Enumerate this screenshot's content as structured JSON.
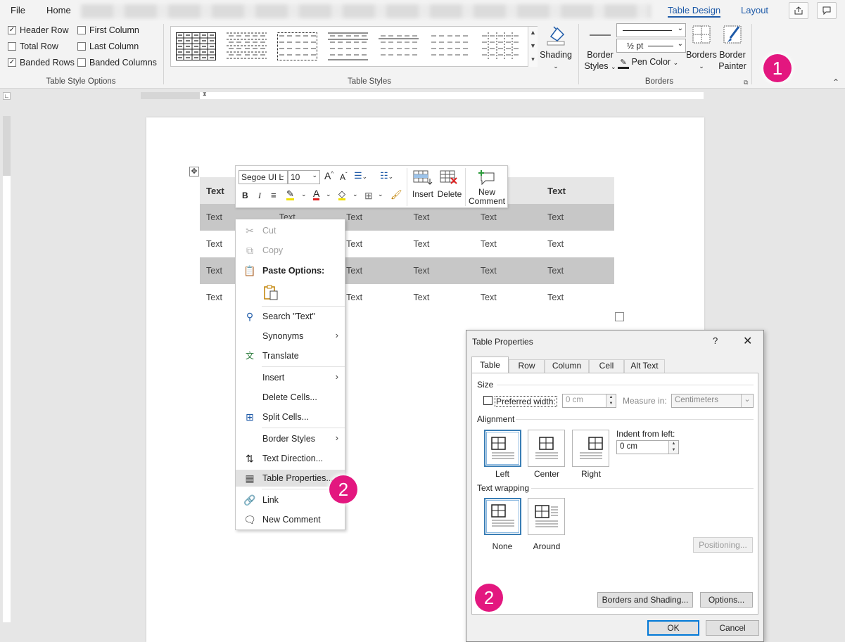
{
  "tabs": {
    "file": "File",
    "home": "Home",
    "table_design": "Table Design",
    "layout": "Layout"
  },
  "style_options": {
    "label": "Table Style Options",
    "items": [
      {
        "label": "Header Row",
        "checked": true
      },
      {
        "label": "Total Row",
        "checked": false
      },
      {
        "label": "Banded Rows",
        "checked": true
      },
      {
        "label": "First Column",
        "checked": false
      },
      {
        "label": "Last Column",
        "checked": false
      },
      {
        "label": "Banded Columns",
        "checked": false
      }
    ]
  },
  "table_styles": {
    "label": "Table Styles",
    "shading": "Shading"
  },
  "borders": {
    "label": "Borders",
    "border_styles_1": "Border",
    "border_styles_2": "Styles",
    "weight": "½ pt",
    "pen_color": "Pen Color",
    "borders_btn": "Borders",
    "painter_1": "Border",
    "painter_2": "Painter"
  },
  "doc_table": {
    "header": [
      "Text",
      "",
      "",
      "",
      "",
      "Text"
    ],
    "rows": [
      [
        "Text",
        "Text",
        "Text",
        "Text",
        "Text",
        "Text"
      ],
      [
        "Text",
        "",
        "Text",
        "Text",
        "Text",
        "Text"
      ],
      [
        "Text",
        "",
        "Text",
        "Text",
        "Text",
        "Text"
      ],
      [
        "Text",
        "",
        "Text",
        "Text",
        "Text",
        "Text"
      ]
    ]
  },
  "mini_toolbar": {
    "font": "Segoe UI L",
    "size": "10",
    "insert": "Insert",
    "delete": "Delete",
    "new_comment_1": "New",
    "new_comment_2": "Comment"
  },
  "context_menu": [
    {
      "label": "Cut",
      "icon": "scissors-icon",
      "disabled": true
    },
    {
      "label": "Copy",
      "icon": "copy-icon",
      "disabled": true
    },
    {
      "label": "Paste Options:",
      "icon": "paste-icon",
      "bold": true
    },
    {
      "label": "Search \"Text\"",
      "icon": "search-icon"
    },
    {
      "label": "Synonyms",
      "submenu": true
    },
    {
      "label": "Translate",
      "icon": "translate-icon"
    },
    {
      "label": "Insert",
      "submenu": true
    },
    {
      "label": "Delete Cells..."
    },
    {
      "label": "Split Cells...",
      "icon": "split-cells-icon"
    },
    {
      "label": "Border Styles",
      "submenu": true
    },
    {
      "label": "Text Direction...",
      "icon": "text-direction-icon"
    },
    {
      "label": "Table Properties...",
      "icon": "table-properties-icon",
      "highlighted": true
    },
    {
      "label": "Link",
      "icon": "link-icon"
    },
    {
      "label": "New Comment",
      "icon": "comment-icon"
    }
  ],
  "badges": {
    "one": "1",
    "two": "2"
  },
  "dialog": {
    "title": "Table Properties",
    "help": "?",
    "tabs": [
      "Table",
      "Row",
      "Column",
      "Cell",
      "Alt Text"
    ],
    "size_label": "Size",
    "preferred_width": "Preferred width:",
    "width_value": "0 cm",
    "measure_in": "Measure in:",
    "measure_value": "Centimeters",
    "alignment_label": "Alignment",
    "align_left": "Left",
    "align_center": "Center",
    "align_right": "Right",
    "indent_label": "Indent from left:",
    "indent_value": "0 cm",
    "wrapping_label": "Text wrapping",
    "wrap_none": "None",
    "wrap_around": "Around",
    "positioning": "Positioning...",
    "borders_shading": "Borders and Shading...",
    "options": "Options...",
    "ok": "OK",
    "cancel": "Cancel"
  },
  "colors": {
    "accent": "#1e5aa8",
    "badge": "#e3177f",
    "highlight": "#f0e000",
    "font_color": "#e02020"
  }
}
